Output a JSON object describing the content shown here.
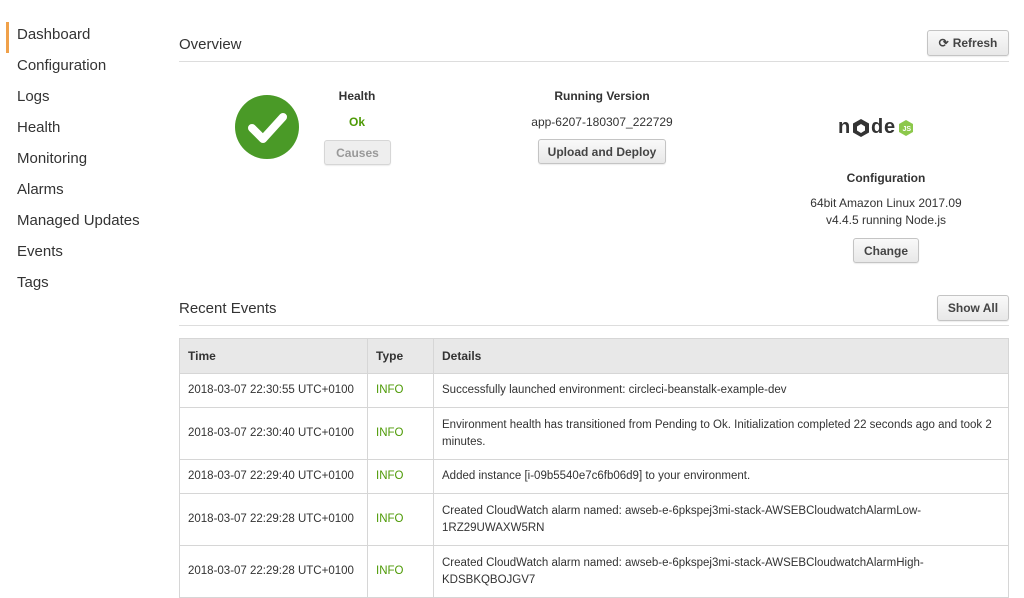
{
  "sidebar": {
    "items": [
      {
        "label": "Dashboard",
        "active": true
      },
      {
        "label": "Configuration"
      },
      {
        "label": "Logs"
      },
      {
        "label": "Health"
      },
      {
        "label": "Monitoring"
      },
      {
        "label": "Alarms"
      },
      {
        "label": "Managed Updates"
      },
      {
        "label": "Events"
      },
      {
        "label": "Tags"
      }
    ]
  },
  "overview": {
    "title": "Overview",
    "refresh_label": "Refresh",
    "health": {
      "label": "Health",
      "status": "Ok",
      "status_color": "#4e9a06",
      "icon": "check-circle-icon",
      "icon_color": "#4a9a27",
      "causes_label": "Causes"
    },
    "running_version": {
      "label": "Running Version",
      "value": "app-6207-180307_222729",
      "upload_label": "Upload and Deploy"
    },
    "configuration": {
      "logo_text": "node",
      "label": "Configuration",
      "line1": "64bit Amazon Linux 2017.09",
      "line2": "v4.4.5 running Node.js",
      "change_label": "Change"
    }
  },
  "recent_events": {
    "title": "Recent Events",
    "show_all_label": "Show All",
    "columns": [
      "Time",
      "Type",
      "Details"
    ],
    "rows": [
      {
        "time": "2018-03-07 22:30:55 UTC+0100",
        "type": "INFO",
        "details": "Successfully launched environment: circleci-beanstalk-example-dev"
      },
      {
        "time": "2018-03-07 22:30:40 UTC+0100",
        "type": "INFO",
        "details": "Environment health has transitioned from Pending to Ok. Initialization completed 22 seconds ago and took 2 minutes."
      },
      {
        "time": "2018-03-07 22:29:40 UTC+0100",
        "type": "INFO",
        "details": "Added instance [i-09b5540e7c6fb06d9] to your environment."
      },
      {
        "time": "2018-03-07 22:29:28 UTC+0100",
        "type": "INFO",
        "details": "Created CloudWatch alarm named: awseb-e-6pkspej3mi-stack-AWSEBCloudwatchAlarmLow-1RZ29UWAXW5RN"
      },
      {
        "time": "2018-03-07 22:29:28 UTC+0100",
        "type": "INFO",
        "details": "Created CloudWatch alarm named: awseb-e-6pkspej3mi-stack-AWSEBCloudwatchAlarmHigh-KDSBKQBOJGV7"
      }
    ]
  }
}
